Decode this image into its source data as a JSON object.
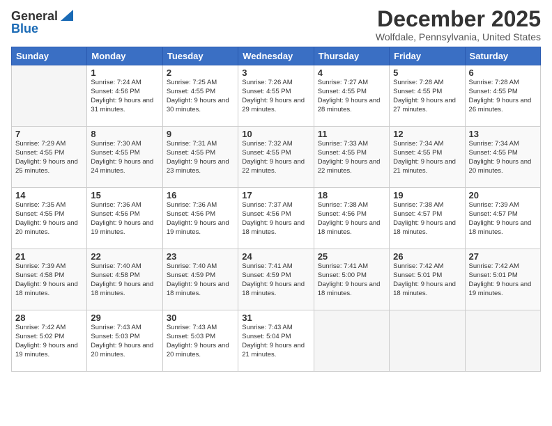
{
  "header": {
    "logo_general": "General",
    "logo_blue": "Blue",
    "month_title": "December 2025",
    "location": "Wolfdale, Pennsylvania, United States"
  },
  "days_of_week": [
    "Sunday",
    "Monday",
    "Tuesday",
    "Wednesday",
    "Thursday",
    "Friday",
    "Saturday"
  ],
  "weeks": [
    [
      {
        "day": "",
        "sunrise": "",
        "sunset": "",
        "daylight": "",
        "empty": true
      },
      {
        "day": "1",
        "sunrise": "Sunrise: 7:24 AM",
        "sunset": "Sunset: 4:56 PM",
        "daylight": "Daylight: 9 hours and 31 minutes."
      },
      {
        "day": "2",
        "sunrise": "Sunrise: 7:25 AM",
        "sunset": "Sunset: 4:55 PM",
        "daylight": "Daylight: 9 hours and 30 minutes."
      },
      {
        "day": "3",
        "sunrise": "Sunrise: 7:26 AM",
        "sunset": "Sunset: 4:55 PM",
        "daylight": "Daylight: 9 hours and 29 minutes."
      },
      {
        "day": "4",
        "sunrise": "Sunrise: 7:27 AM",
        "sunset": "Sunset: 4:55 PM",
        "daylight": "Daylight: 9 hours and 28 minutes."
      },
      {
        "day": "5",
        "sunrise": "Sunrise: 7:28 AM",
        "sunset": "Sunset: 4:55 PM",
        "daylight": "Daylight: 9 hours and 27 minutes."
      },
      {
        "day": "6",
        "sunrise": "Sunrise: 7:28 AM",
        "sunset": "Sunset: 4:55 PM",
        "daylight": "Daylight: 9 hours and 26 minutes."
      }
    ],
    [
      {
        "day": "7",
        "sunrise": "Sunrise: 7:29 AM",
        "sunset": "Sunset: 4:55 PM",
        "daylight": "Daylight: 9 hours and 25 minutes."
      },
      {
        "day": "8",
        "sunrise": "Sunrise: 7:30 AM",
        "sunset": "Sunset: 4:55 PM",
        "daylight": "Daylight: 9 hours and 24 minutes."
      },
      {
        "day": "9",
        "sunrise": "Sunrise: 7:31 AM",
        "sunset": "Sunset: 4:55 PM",
        "daylight": "Daylight: 9 hours and 23 minutes."
      },
      {
        "day": "10",
        "sunrise": "Sunrise: 7:32 AM",
        "sunset": "Sunset: 4:55 PM",
        "daylight": "Daylight: 9 hours and 22 minutes."
      },
      {
        "day": "11",
        "sunrise": "Sunrise: 7:33 AM",
        "sunset": "Sunset: 4:55 PM",
        "daylight": "Daylight: 9 hours and 22 minutes."
      },
      {
        "day": "12",
        "sunrise": "Sunrise: 7:34 AM",
        "sunset": "Sunset: 4:55 PM",
        "daylight": "Daylight: 9 hours and 21 minutes."
      },
      {
        "day": "13",
        "sunrise": "Sunrise: 7:34 AM",
        "sunset": "Sunset: 4:55 PM",
        "daylight": "Daylight: 9 hours and 20 minutes."
      }
    ],
    [
      {
        "day": "14",
        "sunrise": "Sunrise: 7:35 AM",
        "sunset": "Sunset: 4:55 PM",
        "daylight": "Daylight: 9 hours and 20 minutes."
      },
      {
        "day": "15",
        "sunrise": "Sunrise: 7:36 AM",
        "sunset": "Sunset: 4:56 PM",
        "daylight": "Daylight: 9 hours and 19 minutes."
      },
      {
        "day": "16",
        "sunrise": "Sunrise: 7:36 AM",
        "sunset": "Sunset: 4:56 PM",
        "daylight": "Daylight: 9 hours and 19 minutes."
      },
      {
        "day": "17",
        "sunrise": "Sunrise: 7:37 AM",
        "sunset": "Sunset: 4:56 PM",
        "daylight": "Daylight: 9 hours and 18 minutes."
      },
      {
        "day": "18",
        "sunrise": "Sunrise: 7:38 AM",
        "sunset": "Sunset: 4:56 PM",
        "daylight": "Daylight: 9 hours and 18 minutes."
      },
      {
        "day": "19",
        "sunrise": "Sunrise: 7:38 AM",
        "sunset": "Sunset: 4:57 PM",
        "daylight": "Daylight: 9 hours and 18 minutes."
      },
      {
        "day": "20",
        "sunrise": "Sunrise: 7:39 AM",
        "sunset": "Sunset: 4:57 PM",
        "daylight": "Daylight: 9 hours and 18 minutes."
      }
    ],
    [
      {
        "day": "21",
        "sunrise": "Sunrise: 7:39 AM",
        "sunset": "Sunset: 4:58 PM",
        "daylight": "Daylight: 9 hours and 18 minutes."
      },
      {
        "day": "22",
        "sunrise": "Sunrise: 7:40 AM",
        "sunset": "Sunset: 4:58 PM",
        "daylight": "Daylight: 9 hours and 18 minutes."
      },
      {
        "day": "23",
        "sunrise": "Sunrise: 7:40 AM",
        "sunset": "Sunset: 4:59 PM",
        "daylight": "Daylight: 9 hours and 18 minutes."
      },
      {
        "day": "24",
        "sunrise": "Sunrise: 7:41 AM",
        "sunset": "Sunset: 4:59 PM",
        "daylight": "Daylight: 9 hours and 18 minutes."
      },
      {
        "day": "25",
        "sunrise": "Sunrise: 7:41 AM",
        "sunset": "Sunset: 5:00 PM",
        "daylight": "Daylight: 9 hours and 18 minutes."
      },
      {
        "day": "26",
        "sunrise": "Sunrise: 7:42 AM",
        "sunset": "Sunset: 5:01 PM",
        "daylight": "Daylight: 9 hours and 18 minutes."
      },
      {
        "day": "27",
        "sunrise": "Sunrise: 7:42 AM",
        "sunset": "Sunset: 5:01 PM",
        "daylight": "Daylight: 9 hours and 19 minutes."
      }
    ],
    [
      {
        "day": "28",
        "sunrise": "Sunrise: 7:42 AM",
        "sunset": "Sunset: 5:02 PM",
        "daylight": "Daylight: 9 hours and 19 minutes."
      },
      {
        "day": "29",
        "sunrise": "Sunrise: 7:43 AM",
        "sunset": "Sunset: 5:03 PM",
        "daylight": "Daylight: 9 hours and 20 minutes."
      },
      {
        "day": "30",
        "sunrise": "Sunrise: 7:43 AM",
        "sunset": "Sunset: 5:03 PM",
        "daylight": "Daylight: 9 hours and 20 minutes."
      },
      {
        "day": "31",
        "sunrise": "Sunrise: 7:43 AM",
        "sunset": "Sunset: 5:04 PM",
        "daylight": "Daylight: 9 hours and 21 minutes."
      },
      {
        "day": "",
        "sunrise": "",
        "sunset": "",
        "daylight": "",
        "empty": true
      },
      {
        "day": "",
        "sunrise": "",
        "sunset": "",
        "daylight": "",
        "empty": true
      },
      {
        "day": "",
        "sunrise": "",
        "sunset": "",
        "daylight": "",
        "empty": true
      }
    ]
  ]
}
